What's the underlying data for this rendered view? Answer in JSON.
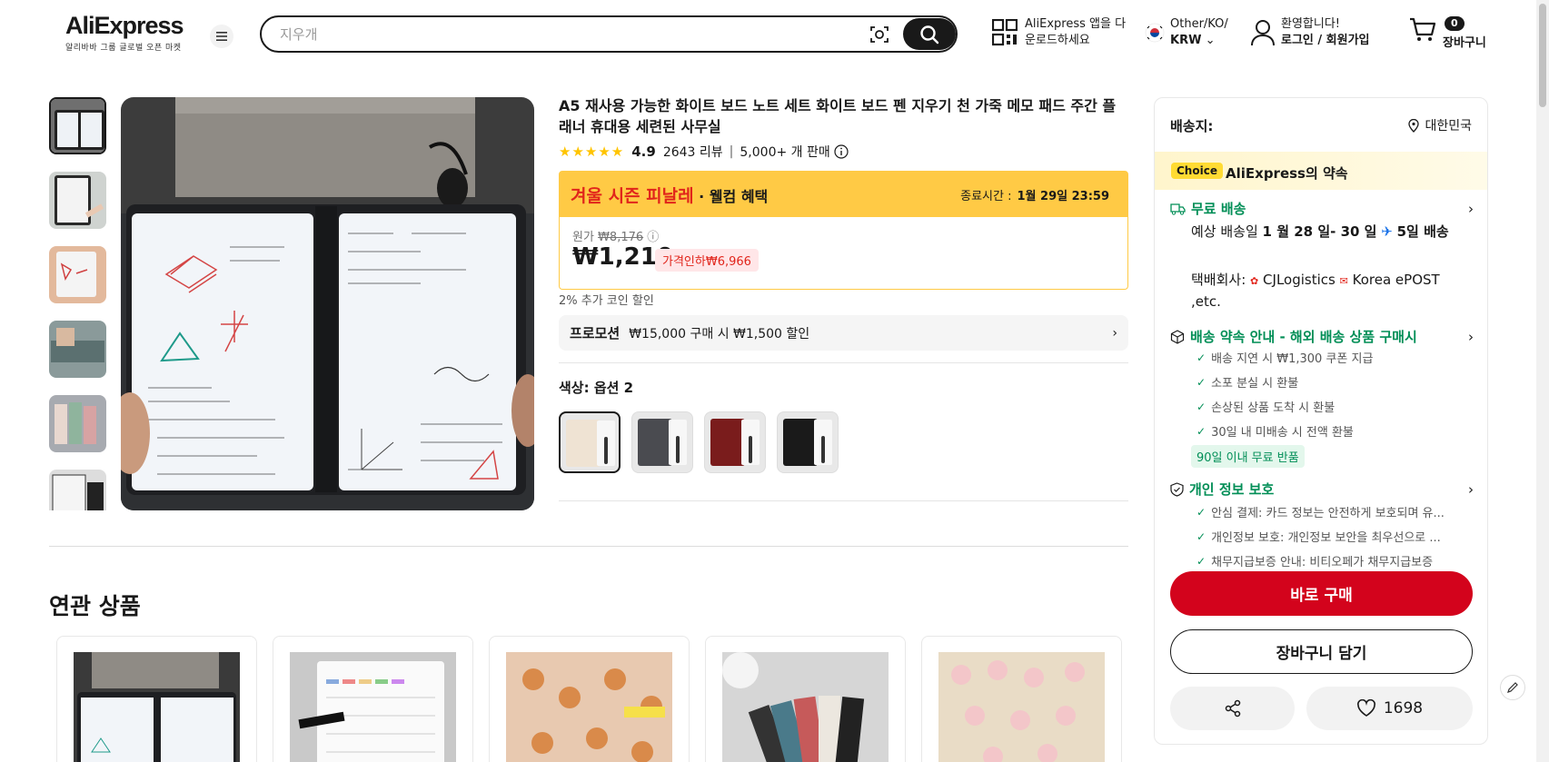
{
  "header": {
    "logo": "AliExpress",
    "logo_sub": "알리바바 그룹 글로벌 오픈 마켓",
    "search_placeholder": "지우개",
    "app_download_line1": "AliExpress 앱을 다",
    "app_download_line2": "운로드하세요",
    "region_line1": "Other/KO/",
    "region_line2": "KRW",
    "account_line1": "환영합니다!",
    "account_line2": "로그인 / 회원가입",
    "cart_count": "0",
    "cart_label": "장바구니"
  },
  "product": {
    "title": "A5 재사용 가능한 화이트 보드 노트 세트 화이트 보드 펜 지우기 천 가죽 메모 패드 주간 플래너 휴대용 세련된 사무실",
    "stars": "★★★★★",
    "rating": "4.9",
    "reviews": "2643 리뷰",
    "sold": "5,000+ 개 판매",
    "sale_name": "겨울 시즌 피날레",
    "sale_sub": " · 웰컴 혜택",
    "sale_end_label": "종료시간 :",
    "sale_end_time": "1월 29일 23:59",
    "orig_label": "원가",
    "orig_price": "₩8,176",
    "price": "₩1,210",
    "discount": "가격인하₩6,966",
    "coin": "2% 추가 코인 할인",
    "promo_label": "프로모션",
    "promo_text": "₩15,000 구매 시 ₩1,500 할인",
    "color_label": "색상: 옵션 2",
    "swatch_colors": [
      "#efe3d3",
      "#4a4b50",
      "#7a1c1c",
      "#1a1a1a"
    ]
  },
  "related": {
    "title": "연관 상품"
  },
  "panel": {
    "ship_to": "배송지:",
    "country": "대한민국",
    "choice_badge": "Choice",
    "choice_text": "AliExpress의 약속",
    "free_ship": "무료 배송",
    "est_prefix": "예상 배송일 ",
    "est_dates": "1 월 28 일- 30 일",
    "est_days": "5일 배송",
    "carrier_label": "택배회사:",
    "carrier_1": "CJLogistics",
    "carrier_2": "Korea ePOST ,etc.",
    "promise_title": "배송 약속 안내 - 해외 배송 상품 구매시",
    "promise_items": [
      "배송 지연 시 ₩1,300 쿠폰 지급",
      "소포 분실 시 환불",
      "손상된 상품 도착 시 환불",
      "30일 내 미배송 시 전액 환불"
    ],
    "return_badge": "90일 이내 무료 반품",
    "privacy_title": "개인 정보 보호",
    "privacy_items": [
      "안심 결제: 카드 정보는 안전하게 보호되며 유...",
      "개인정보 보호: 개인정보 보안을 최우선으로 ...",
      "채무지급보증 안내: 비티오페가 채무지급보증"
    ],
    "buy_now": "바로 구매",
    "add_cart": "장바구니 담기",
    "wishlist_count": "1698"
  },
  "colors": {
    "brand_red": "#d3031c",
    "sale_yellow": "#ffca45",
    "choice_green": "#018e56"
  }
}
